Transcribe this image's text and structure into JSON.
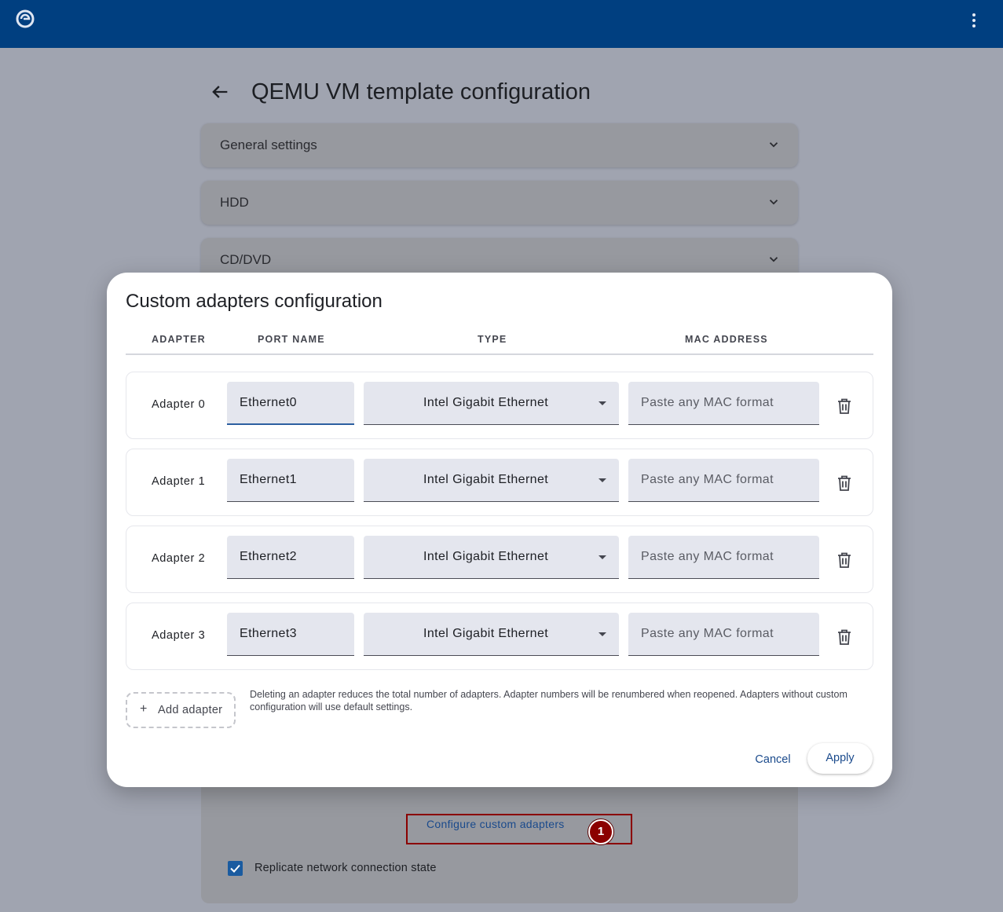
{
  "page": {
    "title": "QEMU VM template configuration",
    "sections": [
      "General settings",
      "HDD",
      "CD/DVD"
    ],
    "configure_link": "Configure custom adapters",
    "replicate_label": "Replicate network connection state",
    "replicate_checked": true,
    "marker_number": "1"
  },
  "dialog": {
    "title": "Custom adapters configuration",
    "columns": [
      "ADAPTER",
      "PORT NAME",
      "TYPE",
      "MAC ADDRESS"
    ],
    "adapters": [
      {
        "label": "Adapter 0",
        "port_name": "Ethernet0",
        "type": "Intel Gigabit Ethernet",
        "mac_placeholder": "Paste any MAC format"
      },
      {
        "label": "Adapter 1",
        "port_name": "Ethernet1",
        "type": "Intel Gigabit Ethernet",
        "mac_placeholder": "Paste any MAC format"
      },
      {
        "label": "Adapter 2",
        "port_name": "Ethernet2",
        "type": "Intel Gigabit Ethernet",
        "mac_placeholder": "Paste any MAC format"
      },
      {
        "label": "Adapter 3",
        "port_name": "Ethernet3",
        "type": "Intel Gigabit Ethernet",
        "mac_placeholder": "Paste any MAC format"
      }
    ],
    "add_button": "Add adapter",
    "add_icon": "+",
    "hint": "Deleting an adapter reduces the total number of adapters. Adapter numbers will be renumbered when reopened. Adapters without custom configuration will use default settings.",
    "cancel": "Cancel",
    "apply": "Apply"
  },
  "colors": {
    "app_bar": "#003f80",
    "accent": "#1a4a8c",
    "highlight": "#8b0000"
  }
}
